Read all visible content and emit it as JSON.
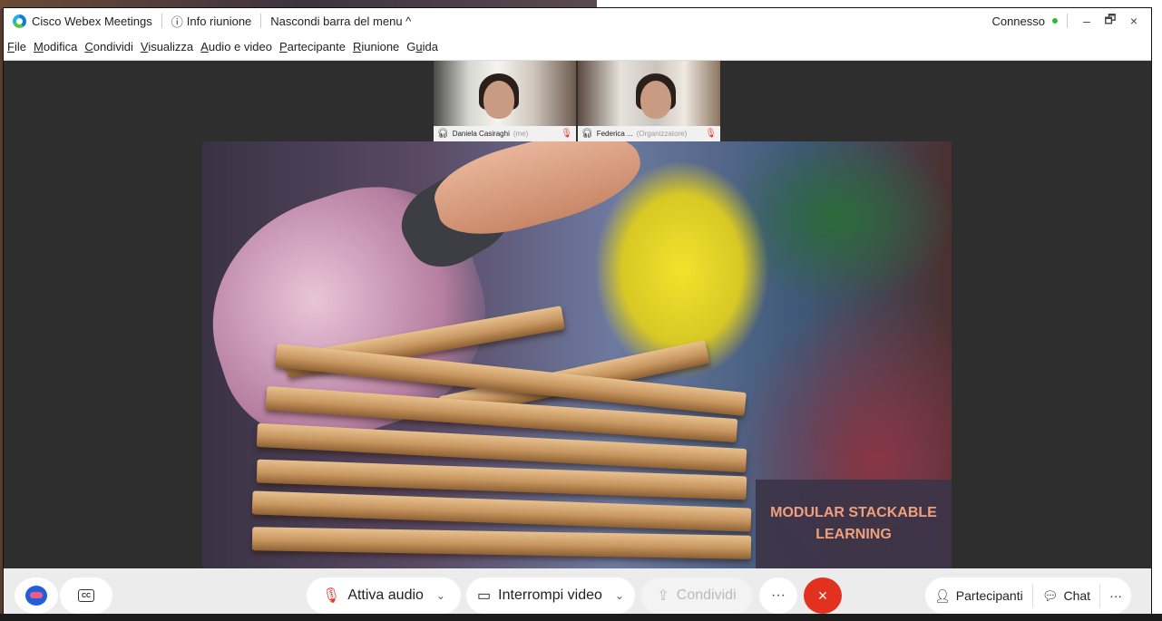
{
  "titlebar": {
    "app_name": "Cisco Webex Meetings",
    "info": "Info riunione",
    "hide_menu": "Nascondi barra del menu ^",
    "status": "Connesso",
    "minimize": "–",
    "restore": "🗗",
    "close": "×"
  },
  "menu": [
    {
      "ul": "F",
      "rest": "ile"
    },
    {
      "ul": "M",
      "rest": "odifica"
    },
    {
      "ul": "C",
      "rest": "ondividi"
    },
    {
      "ul": "V",
      "rest": "isualizza"
    },
    {
      "ul": "A",
      "rest": "udio e video"
    },
    {
      "ul": "P",
      "rest": "artecipante"
    },
    {
      "ul": "R",
      "rest": "iunione"
    },
    {
      "pre": "G",
      "ul": "u",
      "rest": "ida"
    }
  ],
  "participants": [
    {
      "name": "Daniela Casiraghi",
      "sub": "(me)"
    },
    {
      "name": "Federica ...",
      "sub": "(Organizzatore)"
    }
  ],
  "slide": {
    "line1": "MODULAR STACKABLE",
    "line2": "LEARNING"
  },
  "controls": {
    "audio": "Attiva audio",
    "video": "Interrompi video",
    "share": "Condividi",
    "more": "···",
    "end": "×",
    "participants": "Partecipanti",
    "chat": "Chat",
    "more_right": "···"
  },
  "colors": {
    "end_red": "#e2321f",
    "mute_red": "#e03a2f",
    "connected_green": "#2dbd3a",
    "slide_title": "#f0a07c"
  }
}
